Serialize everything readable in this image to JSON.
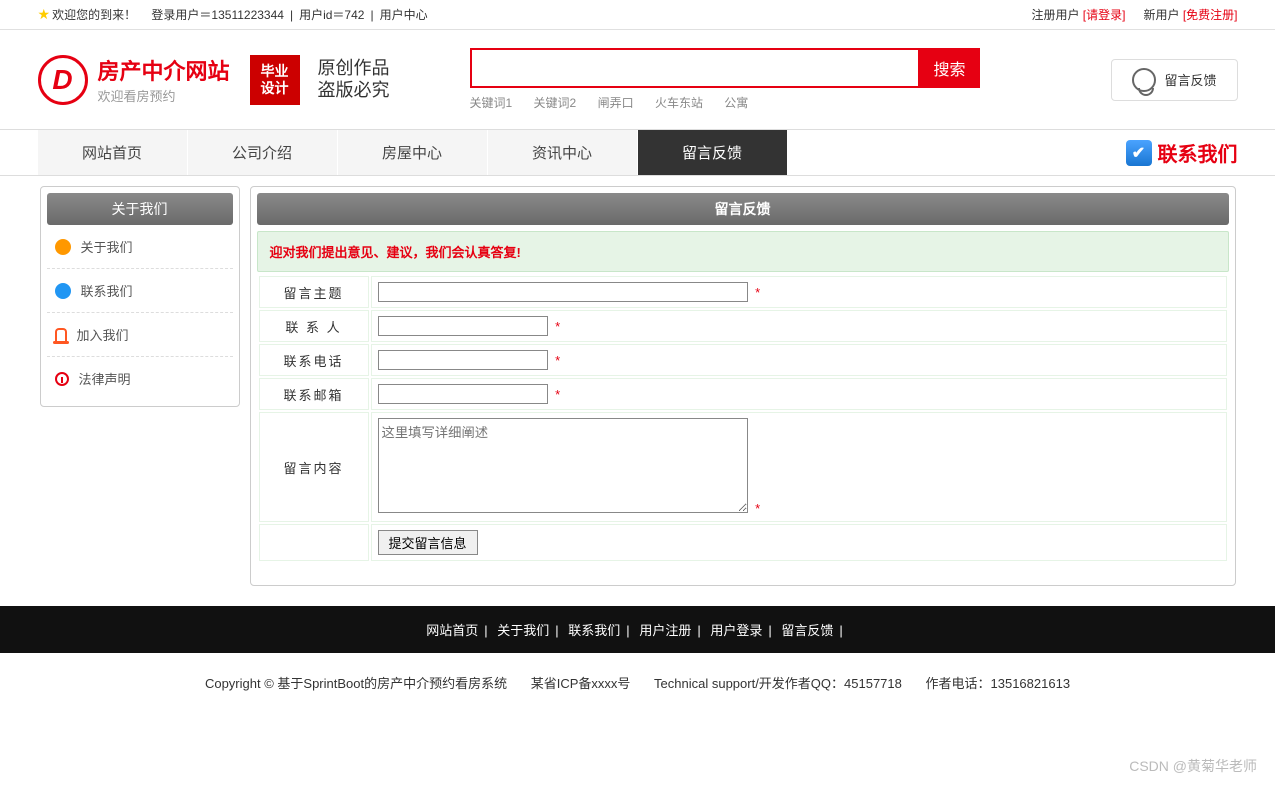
{
  "topbar": {
    "welcome": "欢迎您的到来！",
    "loginUser": "登录用户＝13511223344",
    "userId": "用户id＝742",
    "userCenter": "用户中心",
    "registeredUser": "注册用户",
    "pleaseLogin": "[请登录]",
    "newUser": "新用户",
    "freeRegister": "[免费注册]"
  },
  "logo": {
    "title": "房产中介网站",
    "subtitle": "欢迎看房预约",
    "badge1": "毕业",
    "badge2": "设计",
    "call1": "原创作品",
    "call2": "盗版必究"
  },
  "search": {
    "button": "搜索",
    "kw1": "关键词1",
    "kw2": "关键词2",
    "kw3": "闸弄口",
    "kw4": "火车东站",
    "kw5": "公寓"
  },
  "feedbackBtn": "留言反馈",
  "nav": {
    "items": [
      "网站首页",
      "公司介绍",
      "房屋中心",
      "资讯中心",
      "留言反馈"
    ],
    "active": 4,
    "contact": "联系我们"
  },
  "sidebar": {
    "header": "关于我们",
    "items": [
      "关于我们",
      "联系我们",
      "加入我们",
      "法律声明"
    ]
  },
  "content": {
    "header": "留言反馈",
    "banner": "迎对我们提出意见、建议，我们会认真答复!",
    "labels": {
      "subject": "留言主题",
      "contact": "联 系 人",
      "phone": "联系电话",
      "email": "联系邮箱",
      "body": "留言内容"
    },
    "placeholder": "这里填写详细阐述",
    "required": "*",
    "submit": "提交留言信息"
  },
  "footer": {
    "links": [
      "网站首页",
      "关于我们",
      "联系我们",
      "用户注册",
      "用户登录",
      "留言反馈"
    ],
    "copyright": "Copyright © 基于SprintBoot的房产中介预约看房系统",
    "icp": "某省ICP备xxxx号",
    "tech": "Technical support/开发作者QQ：45157718",
    "authorPhone": "作者电话：13516821613"
  },
  "watermark": "CSDN @黄菊华老师"
}
